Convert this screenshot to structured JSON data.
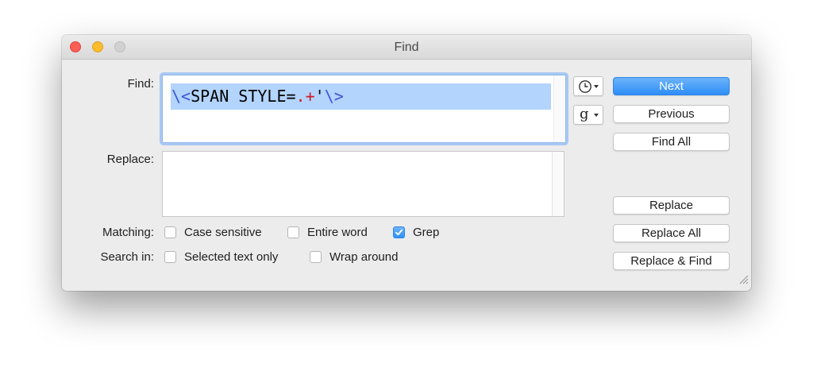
{
  "window": {
    "title": "Find"
  },
  "labels": {
    "find": "Find:",
    "replace": "Replace:",
    "matching": "Matching:",
    "search_in": "Search in:"
  },
  "find_field": {
    "value": "\\<SPAN STYLE=.+'\\>",
    "segments": [
      {
        "text": "\\<",
        "kind": "escape"
      },
      {
        "text": "SPAN STYLE=",
        "kind": "plain"
      },
      {
        "text": ".",
        "kind": "meta"
      },
      {
        "text": "+",
        "kind": "meta"
      },
      {
        "text": "'",
        "kind": "plain"
      },
      {
        "text": "\\>",
        "kind": "escape"
      }
    ]
  },
  "replace_field": {
    "value": ""
  },
  "popups": {
    "recent": {
      "icon": "clock-icon"
    },
    "grep_patterns": {
      "glyph": "g"
    }
  },
  "buttons": {
    "next": "Next",
    "previous": "Previous",
    "find_all": "Find All",
    "replace": "Replace",
    "replace_all": "Replace All",
    "replace_and_find": "Replace & Find"
  },
  "options": {
    "case_sensitive": {
      "label": "Case sensitive",
      "checked": false
    },
    "entire_word": {
      "label": "Entire word",
      "checked": false
    },
    "grep": {
      "label": "Grep",
      "checked": true
    },
    "selected_text_only": {
      "label": "Selected text only",
      "checked": false
    },
    "wrap_around": {
      "label": "Wrap around",
      "checked": false
    }
  },
  "colors": {
    "accent": "#2e8ef7",
    "selection": "#b3d4fc",
    "escape_token": "#3c56d6",
    "meta_token": "#d01c2c"
  }
}
